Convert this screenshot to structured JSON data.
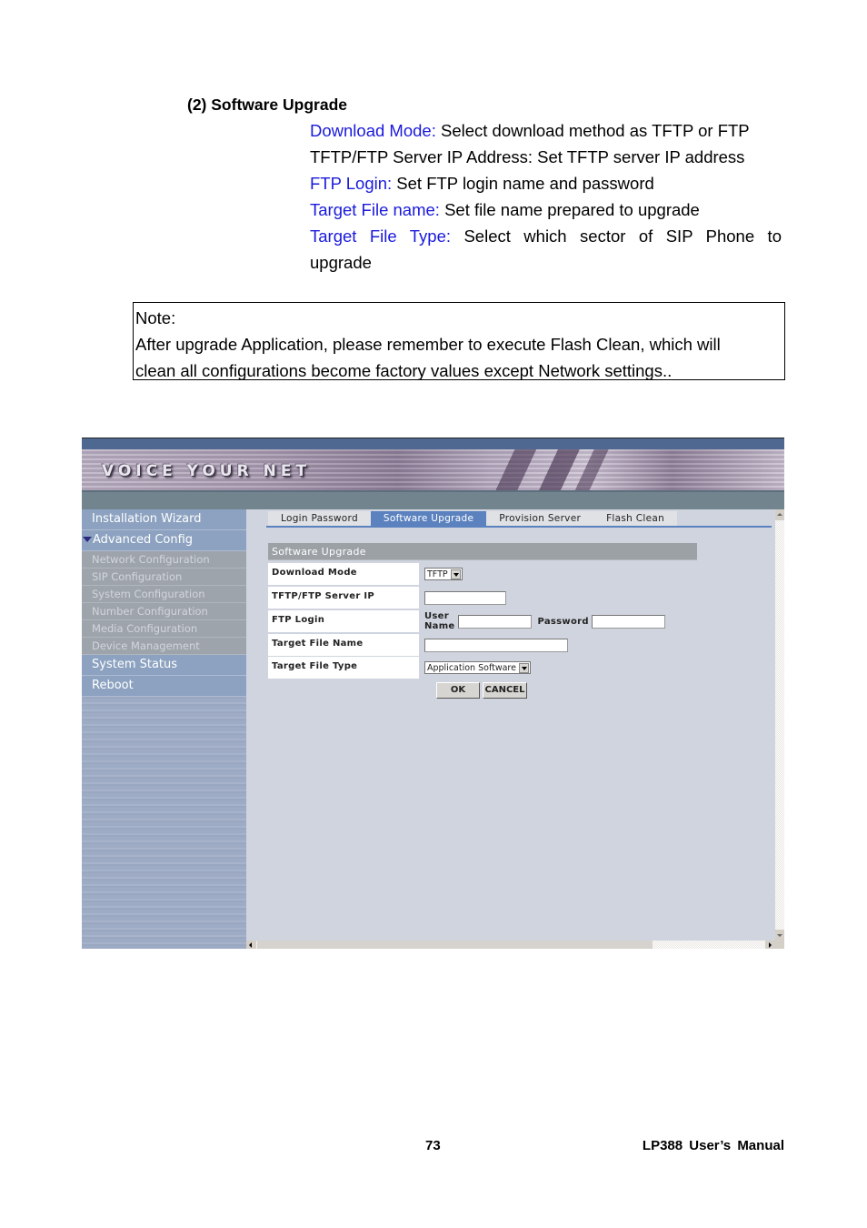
{
  "document": {
    "heading": "(2) Software Upgrade",
    "descriptions": [
      {
        "key": "Download Mode:",
        "text": " Select download method as TFTP or FTP",
        "key_colored": true
      },
      {
        "key": "TFTP/FTP Server IP Address:",
        "text": " Set TFTP server IP address",
        "key_colored": false
      },
      {
        "key": "FTP Login:",
        "text": " Set FTP login name and password",
        "key_colored": true
      },
      {
        "key": "Target File name:",
        "text": " Set file name prepared to upgrade",
        "key_colored": true
      },
      {
        "key": "Target File Type:",
        "text": " Select which sector of SIP Phone to",
        "continuation": "upgrade",
        "key_colored": true
      }
    ],
    "note": {
      "title": "Note:",
      "line1": "After upgrade Application, please remember to execute Flash Clean, which will",
      "line2": "clean all configurations become factory values except Network settings.."
    },
    "footer": {
      "page_number": "73",
      "manual_title": "LP388  User’s  Manual"
    },
    "colors": {
      "key_text": "#1a1adb",
      "body_text": "#000000"
    }
  },
  "ui": {
    "banner_logo": "VOICE YOUR NET",
    "sidebar": {
      "items": [
        {
          "label": "Installation Wizard",
          "level": "main"
        },
        {
          "label": "Advanced Config",
          "level": "main",
          "expanded": true
        },
        {
          "label": "Network Configuration",
          "level": "sub"
        },
        {
          "label": "SIP Configuration",
          "level": "sub"
        },
        {
          "label": "System Configuration",
          "level": "sub"
        },
        {
          "label": "Number Configuration",
          "level": "sub"
        },
        {
          "label": "Media Configuration",
          "level": "sub"
        },
        {
          "label": "Device Management",
          "level": "sub"
        },
        {
          "label": "System Status",
          "level": "main"
        },
        {
          "label": "Reboot",
          "level": "main"
        }
      ]
    },
    "tabs": [
      {
        "label": "Login Password",
        "active": false
      },
      {
        "label": "Software Upgrade",
        "active": true
      },
      {
        "label": "Provision Server",
        "active": false
      },
      {
        "label": "Flash Clean",
        "active": false
      }
    ],
    "section_title": "Software Upgrade",
    "form": {
      "download_mode": {
        "label": "Download Mode",
        "value": "TFTP"
      },
      "server_ip": {
        "label": "TFTP/FTP Server IP Address",
        "value": ""
      },
      "ftp_login": {
        "label": "FTP Login",
        "username_label": "User Name",
        "username_value": "",
        "password_label": "Password",
        "password_value": ""
      },
      "target_file_name": {
        "label": "Target File Name",
        "value": ""
      },
      "target_file_type": {
        "label": "Target File Type",
        "value": "Application Software"
      }
    },
    "buttons": {
      "ok": "OK",
      "cancel": "CANCEL"
    },
    "colors": {
      "active_tab": "#5b82bf",
      "sidebar_main": "#8ca2c0",
      "sidebar_sub": "#9ea4ac",
      "content_bg": "#cfd4de",
      "section_header": "#9ca1a6"
    }
  }
}
